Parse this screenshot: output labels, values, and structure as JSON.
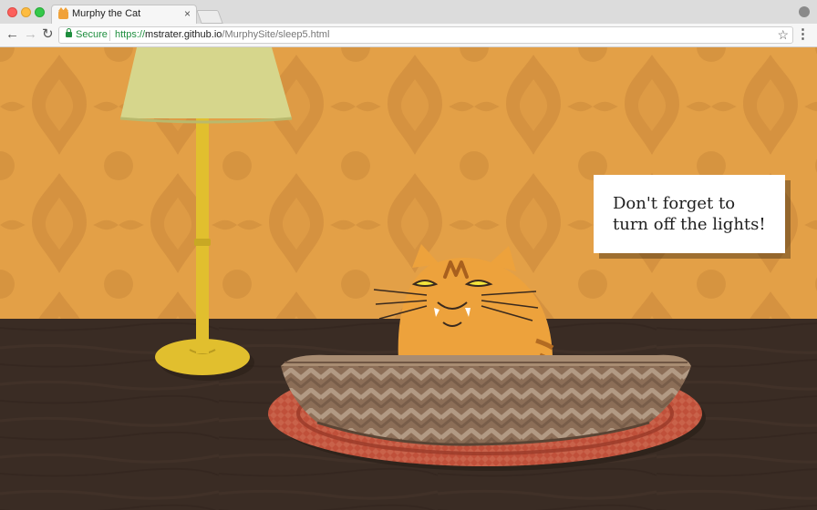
{
  "browser": {
    "tab_title": "Murphy the Cat",
    "tab_close": "×",
    "favicon": "cat-favicon-icon",
    "secure_label": "Secure",
    "url_scheme": "https://",
    "url_host": "mstrater.github.io",
    "url_path": "/MurphySite/sleep5.html",
    "icons": {
      "back": "back-arrow-icon",
      "forward": "forward-arrow-icon",
      "reload": "reload-icon",
      "lock": "lock-icon",
      "bookmark": "star-icon",
      "menu": "kebab-menu-icon",
      "profile": "profile-icon"
    }
  },
  "scene": {
    "message_line1": "Don't forget to",
    "message_line2": "turn off the lights!",
    "colors": {
      "wallpaper": "#e3a047",
      "floor": "#3a2c24",
      "lamp_shade": "#d6d68c",
      "lamp_brass": "#e1bf2e",
      "cat": "#eda23c",
      "basket": "#8c6e57",
      "rug": "#c0503a"
    }
  }
}
